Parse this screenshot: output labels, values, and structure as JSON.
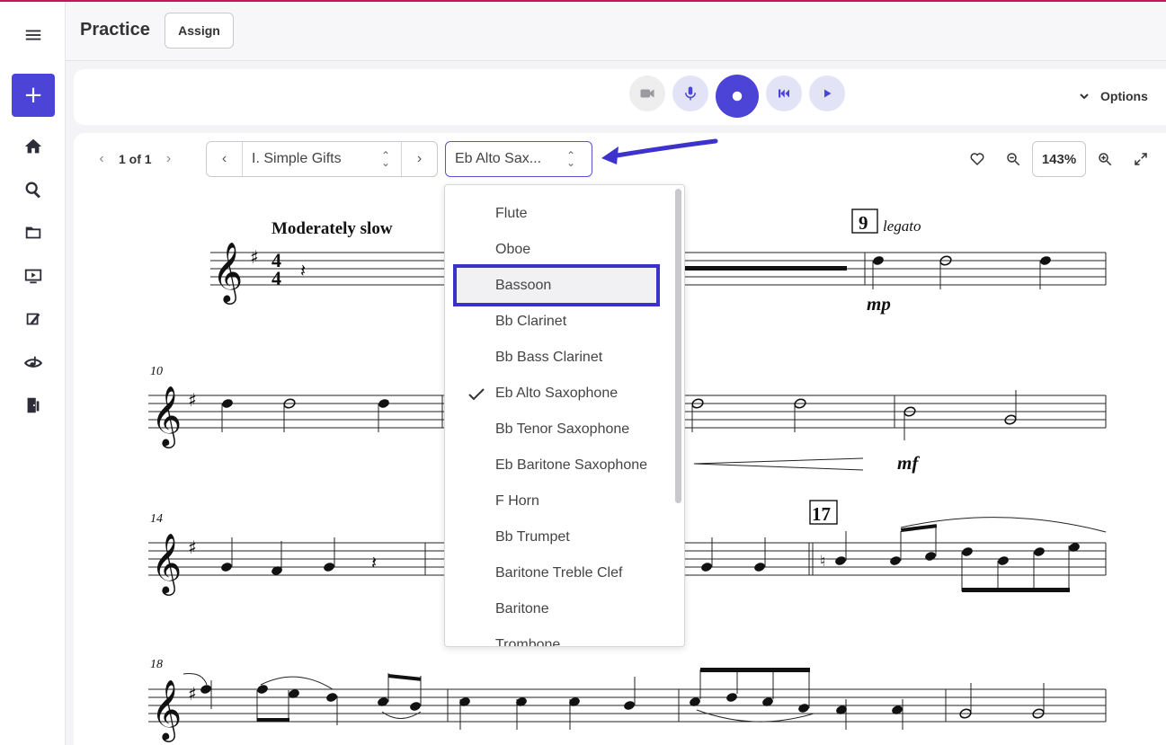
{
  "app": {
    "page_title": "Practice",
    "assign_label": "Assign"
  },
  "sidebar": {
    "new_label": "+",
    "items": [
      {
        "icon": "home-icon"
      },
      {
        "icon": "search-icon"
      },
      {
        "icon": "folder-icon"
      },
      {
        "icon": "play-screen-icon"
      },
      {
        "icon": "assignment-icon"
      },
      {
        "icon": "eye-music-icon"
      },
      {
        "icon": "door-exit-icon"
      }
    ]
  },
  "transport": {
    "options_label": "Options",
    "colors": {
      "active": "#4b44d6",
      "soft": "#e3e3f7",
      "disabled": "#eeeeef"
    }
  },
  "score": {
    "page_indicator": "1 of 1",
    "movement": "I. Simple Gifts",
    "instrument": "Eb Alto Sax...",
    "zoom": "143%"
  },
  "notation": {
    "tempo": "Moderately slow",
    "time_sig_top": "4",
    "time_sig_bottom": "4",
    "rehearsal_9": "9",
    "rehearsal_17": "17",
    "legato": "legato",
    "dyn_mp": "mp",
    "dyn_mf": "mf",
    "measure_10": "10",
    "measure_14": "14",
    "measure_18": "18"
  },
  "dropdown": {
    "selected": "Eb Alto Saxophone",
    "highlighted": "Bassoon",
    "items": [
      "Flute",
      "Oboe",
      "Bassoon",
      "Bb Clarinet",
      "Bb Bass Clarinet",
      "Eb Alto Saxophone",
      "Bb Tenor Saxophone",
      "Eb Baritone Saxophone",
      "F Horn",
      "Bb Trumpet",
      "Baritone Treble Clef",
      "Baritone",
      "Trombone"
    ]
  }
}
